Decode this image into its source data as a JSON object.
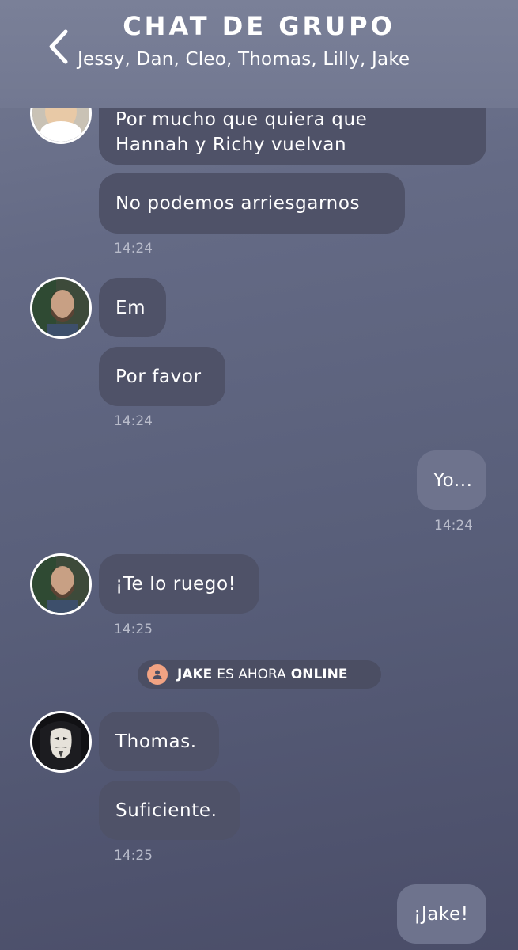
{
  "header": {
    "title": "CHAT DE GRUPO",
    "participants": "Jessy, Dan, Cleo, Thomas, Lilly, Jake"
  },
  "messages": {
    "m1": {
      "line1": "Por mucho que quiera que",
      "line2": "Hannah y Richy vuelvan"
    },
    "m2": "No podemos arriesgarnos",
    "t1": "14:24",
    "m3": "Em",
    "m4": "Por favor",
    "t2": "14:24",
    "m5": "Yo...",
    "t3": "14:24",
    "m6": "¡Te lo ruego!",
    "t4": "14:25",
    "m7": "Thomas.",
    "m8": "Suficiente.",
    "t5": "14:25",
    "m9": "¡Jake!"
  },
  "status": {
    "user": "JAKE",
    "text": "ES AHORA",
    "state": "ONLINE"
  },
  "colors": {
    "incoming_bubble": "#4f5268",
    "outgoing_bubble": "#6e738d",
    "status_icon": "#f2a383"
  }
}
